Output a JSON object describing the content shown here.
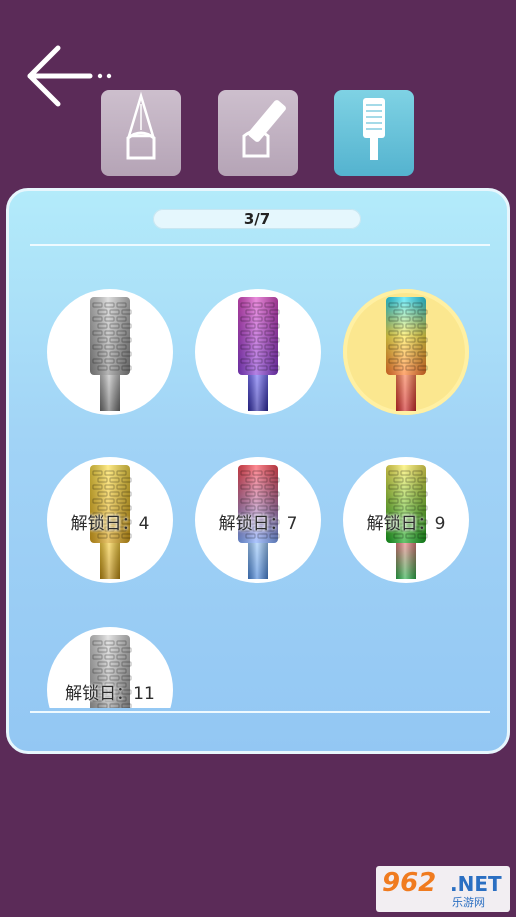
{
  "nav": {
    "back_icon": "arrow-left-icon"
  },
  "tabs": [
    {
      "name": "nail-shape-tab",
      "icon": "nail-file-shape-icon",
      "active": false
    },
    {
      "name": "nail-polish-tab",
      "icon": "nail-brush-icon",
      "active": false
    },
    {
      "name": "drill-bit-tab",
      "icon": "drill-bit-icon",
      "active": true
    }
  ],
  "progress": {
    "label": "3/7"
  },
  "drill_bits": [
    {
      "colors": [
        "#cfcfcf",
        "#8c8c8c"
      ],
      "shank": [
        "#c8c8c8",
        "#6a6a6a"
      ],
      "locked": false,
      "selected": false
    },
    {
      "colors": [
        "#e04fc9",
        "#8a3fd6"
      ],
      "shank": [
        "#7e78ff",
        "#2e2aa3"
      ],
      "locked": false,
      "selected": false
    },
    {
      "colors": [
        "#28e0ff",
        "#ffe94a",
        "#ff7a2a"
      ],
      "shank": [
        "#ff8a5a",
        "#d02a2a"
      ],
      "locked": false,
      "selected": true
    },
    {
      "colors": [
        "#ffe14a",
        "#d9a21b"
      ],
      "shank": [
        "#ffd84a",
        "#b7870f"
      ],
      "locked": true,
      "label": "解锁日：4",
      "selected": false
    },
    {
      "colors": [
        "#ff4a55",
        "#7ea8ff"
      ],
      "shank": [
        "#a9d3ff",
        "#4a86d9"
      ],
      "locked": true,
      "label": "解锁日：7",
      "selected": false
    },
    {
      "colors": [
        "#fff05a",
        "#13a31f"
      ],
      "shank": [
        "#ff7a8a",
        "#2bb04a"
      ],
      "locked": true,
      "label": "解锁日：9",
      "selected": false
    },
    {
      "colors": [
        "#d7d7d7",
        "#9e9e9e"
      ],
      "shank": [
        "#c8c8c8",
        "#8a8a8a"
      ],
      "locked": true,
      "label": "解锁日：11",
      "selected": false
    }
  ],
  "watermark": {
    "number": "962",
    "domain": ".NET",
    "site": "乐游网"
  }
}
